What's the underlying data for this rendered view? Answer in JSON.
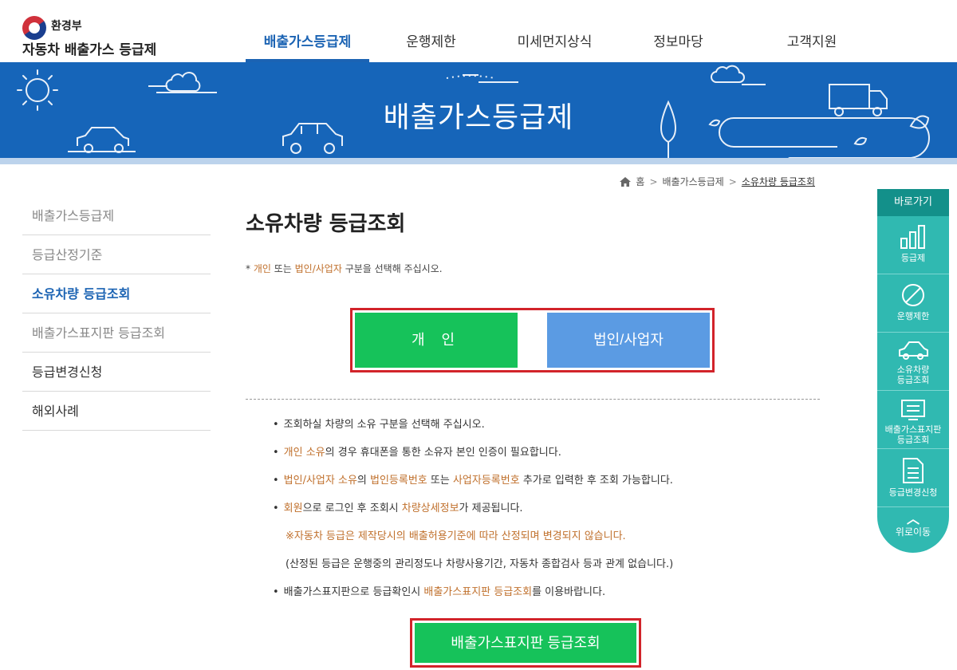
{
  "header": {
    "org": "환경부",
    "site": "자동차 배출가스 등급제",
    "nav": [
      {
        "label": "배출가스등급제",
        "active": true
      },
      {
        "label": "운행제한",
        "active": false
      },
      {
        "label": "미세먼지상식",
        "active": false
      },
      {
        "label": "정보마당",
        "active": false
      },
      {
        "label": "고객지원",
        "active": false
      }
    ]
  },
  "banner": {
    "title": "배출가스등급제"
  },
  "breadcrumb": {
    "home": "홈",
    "section": "배출가스등급제",
    "current": "소유차량 등급조회"
  },
  "sidebar": {
    "items": [
      {
        "label": "배출가스등급제"
      },
      {
        "label": "등급산정기준"
      },
      {
        "label": "소유차량 등급조회"
      },
      {
        "label": "배출가스표지판 등급조회"
      },
      {
        "label": "등급변경신청"
      },
      {
        "label": "해외사례"
      }
    ]
  },
  "main": {
    "title": "소유차량 등급조회",
    "notice": {
      "prefix": "* ",
      "individual": "개인",
      "or": " 또는 ",
      "corporate": "법인/사업자",
      "suffix": " 구분을 선택해 주십시오."
    },
    "buttons": {
      "personal": "개 인",
      "corporate": "법인/사업자"
    },
    "guide": {
      "line1": "조회하실 차량의 소유 구분을 선택해 주십시오.",
      "line2_hl": "개인 소유",
      "line2_rest": "의 경우 휴대폰을 통한 소유자 본인 인증이 필요합니다.",
      "line3_hl1": "법인/사업자 소유",
      "line3_mid1": "의 ",
      "line3_hl2": "법인등록번호",
      "line3_mid2": " 또는 ",
      "line3_hl3": "사업자등록번호",
      "line3_rest": " 추가로 입력한 후 조회 가능합니다.",
      "line4_hl1": "회원",
      "line4_mid": "으로 로그인 후 조회시 ",
      "line4_hl2": "차량상세정보",
      "line4_rest": "가 제공됩니다.",
      "warn": "※자동차 등급은 제작당시의 배출허용기준에 따라 산정되며 변경되지 않습니다.",
      "paren": "(산정된 등급은 운행중의 관리정도나 차량사용기간, 자동차 종합검사 등과 관계 없습니다.)",
      "line7_pre": "배출가스표지판으로 등급확인시 ",
      "line7_hl": "배출가스표지판 등급조회",
      "line7_rest": "를 이용바랍니다."
    },
    "search_button": "배출가스표지판 등급조회"
  },
  "quick_menu": {
    "title": "바로가기",
    "items": [
      {
        "icon": "bar-chart-icon",
        "label": "등급제"
      },
      {
        "icon": "no-entry-icon",
        "label": "운행제한"
      },
      {
        "icon": "car-icon",
        "label1": "소유차량",
        "label2": "등급조회"
      },
      {
        "icon": "sign-board-icon",
        "label1": "배출가스표지판",
        "label2": "등급조회"
      },
      {
        "icon": "document-icon",
        "label": "등급변경신청"
      }
    ],
    "top_label": "위로이동"
  },
  "colors": {
    "brand_blue": "#1665b9",
    "active_blue": "#1b63b3",
    "green": "#16c25a",
    "light_blue_button": "#5b9be3",
    "highlight": "#c0702c",
    "red_border": "#d2232a",
    "teal": "#30b9b1"
  }
}
